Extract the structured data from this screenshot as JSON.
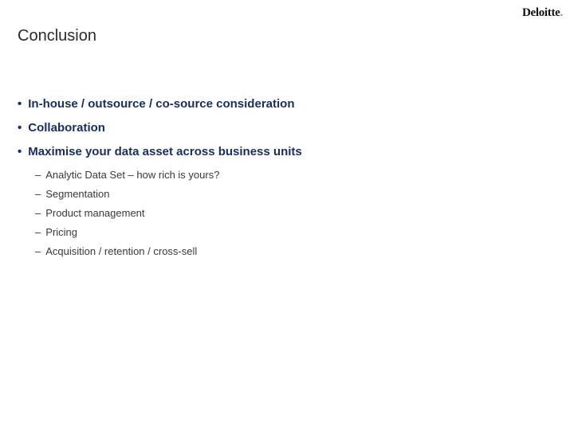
{
  "logo": {
    "text": "Deloitte",
    "dot": "."
  },
  "title": "Conclusion",
  "bullets": [
    {
      "text": "In-house / outsource / co-source consideration"
    },
    {
      "text": "Collaboration"
    },
    {
      "text": "Maximise your data asset across business units"
    }
  ],
  "subitems": [
    "Analytic Data Set – how rich is yours?",
    "Segmentation",
    "Product management",
    "Pricing",
    "Acquisition / retention / cross-sell"
  ]
}
